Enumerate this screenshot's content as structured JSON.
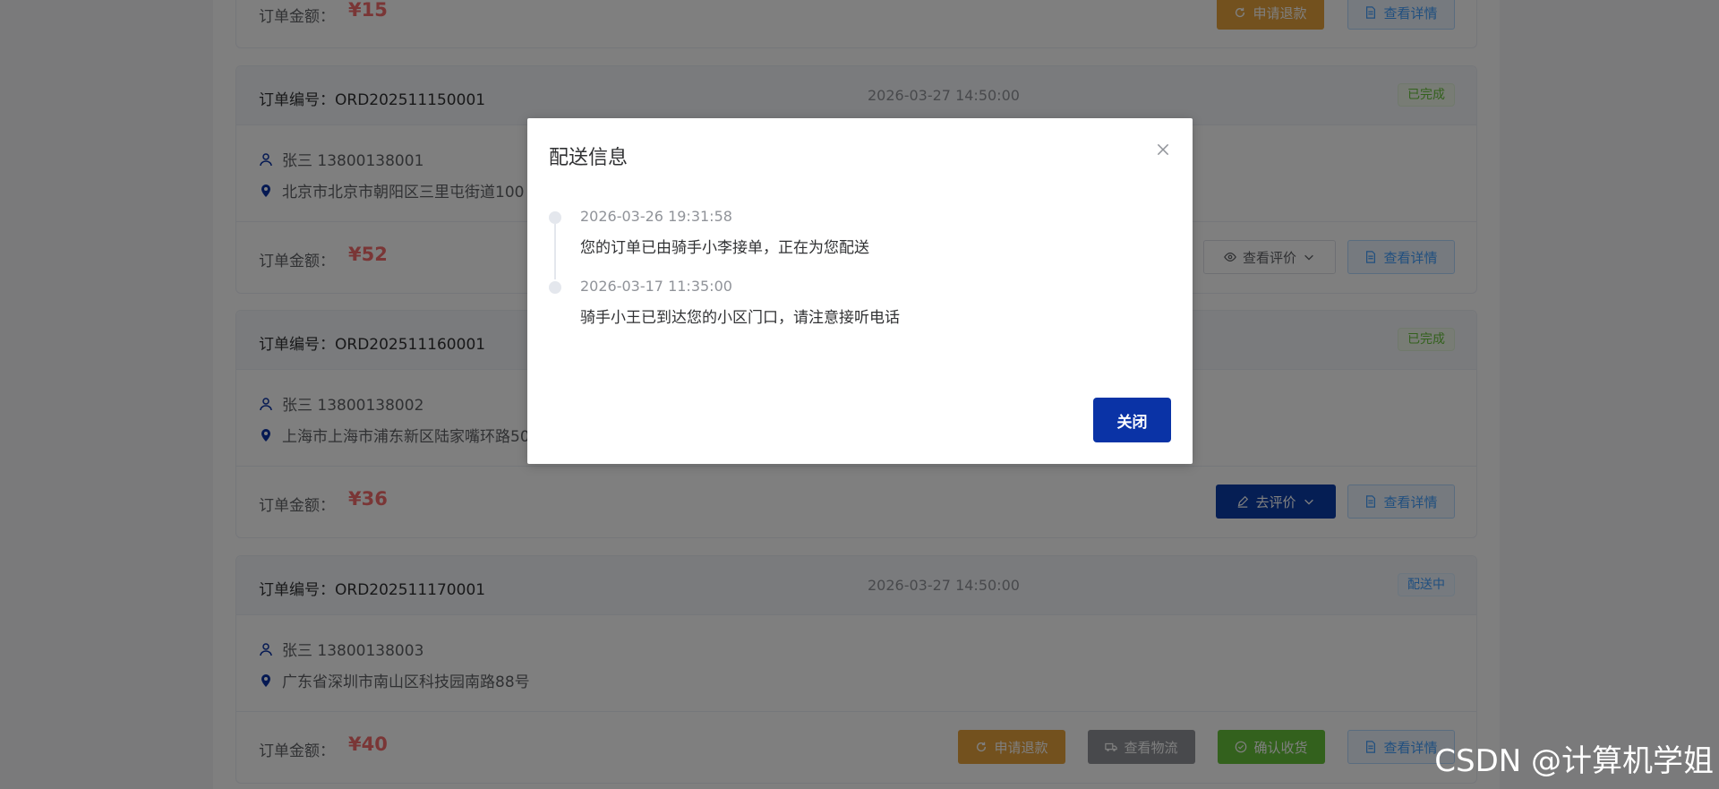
{
  "orders": [
    {
      "amount_label": "订单金额：",
      "amount": "¥15",
      "buttons": {
        "refund": "申请退款",
        "detail": "查看详情"
      }
    },
    {
      "order_no": "订单编号：ORD202511150001",
      "time": "2026-03-27 14:50:00",
      "status": "已完成",
      "contact": "张三 13800138001",
      "address": "北京市北京市朝阳区三里屯街道100",
      "amount_label": "订单金额：",
      "amount": "¥52",
      "buttons": {
        "review": "查看评价",
        "detail": "查看详情"
      }
    },
    {
      "order_no": "订单编号：ORD202511160001",
      "status": "已完成",
      "contact": "张三 13800138002",
      "address": "上海市上海市浦东新区陆家嘴环路50",
      "amount_label": "订单金额：",
      "amount": "¥36",
      "buttons": {
        "goreview": "去评价",
        "detail": "查看详情"
      }
    },
    {
      "order_no": "订单编号：ORD202511170001",
      "time": "2026-03-27 14:50:00",
      "status": "配送中",
      "contact": "张三 13800138003",
      "address": "广东省深圳市南山区科技园南路88号",
      "amount_label": "订单金额：",
      "amount": "¥40",
      "buttons": {
        "refund": "申请退款",
        "logistics": "查看物流",
        "confirm": "确认收货",
        "detail": "查看详情"
      }
    }
  ],
  "dialog": {
    "title": "配送信息",
    "close_label": "关闭",
    "timeline": [
      {
        "time": "2026-03-26 19:31:58",
        "content": "您的订单已由骑手小李接单，正在为您配送"
      },
      {
        "time": "2026-03-17 11:35:00",
        "content": "骑手小王已到达您的小区门口，请注意接听电话"
      }
    ]
  },
  "watermark": "CSDN @计算机学姐",
  "colors": {
    "primary": "#0a33a6",
    "price": "#f56c6c",
    "success": "#67c23a",
    "warning": "#e6a23c",
    "info": "#909399"
  }
}
